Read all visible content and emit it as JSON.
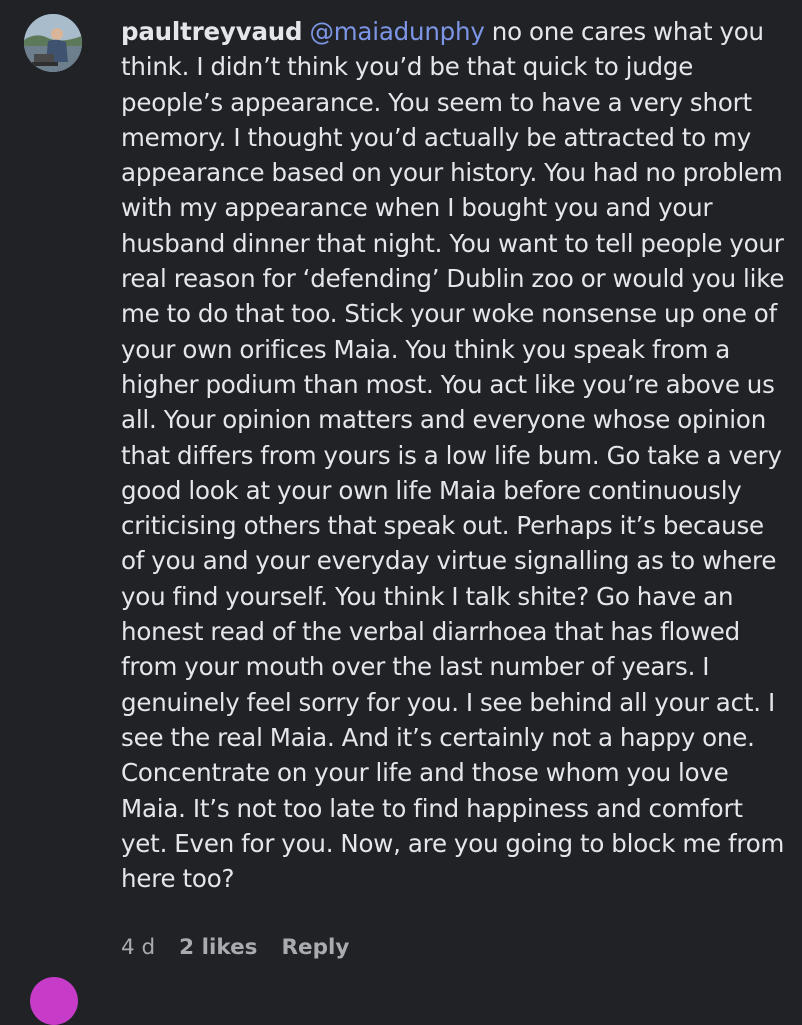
{
  "comment": {
    "username": "paultreyvaud",
    "mention": "@maiadunphy",
    "text": "no one cares what you think. I didn’t think you’d be that quick to judge people’s appearance. You seem to have a very short memory. I thought you’d actually be attracted to my appearance based on your history. You had no problem with my appearance when I bought you and your husband dinner that night. You want to tell people your real reason for ‘defending’ Dublin zoo or would you like me to do that too. Stick your woke nonsense up one of your own orifices Maia. You think you speak from a higher podium than most. You act like you’re above us all. Your opinion matters and everyone whose opinion that differs from yours is a low life bum. Go take a very good look at your own life Maia before continuously criticising others that speak out. Perhaps it’s because of you and your everyday virtue signalling as to where you find yourself. You think I talk shite? Go have an honest read of the verbal diarrhoea that has flowed from your mouth over the last number of years. I genuinely feel sorry for you. I see behind all your act. I see the real Maia. And it’s certainly not a happy one. Concentrate on your life and those whom you love Maia. It’s not too late to find happiness and comfort yet. Even for you. Now, are you going to block me from here too?",
    "time": "4 d",
    "likes": "2 likes",
    "reply_label": "Reply"
  },
  "colors": {
    "background": "#212226",
    "text": "#e4e6eb",
    "mention": "#7c95e6",
    "meta": "#a8abb0"
  }
}
